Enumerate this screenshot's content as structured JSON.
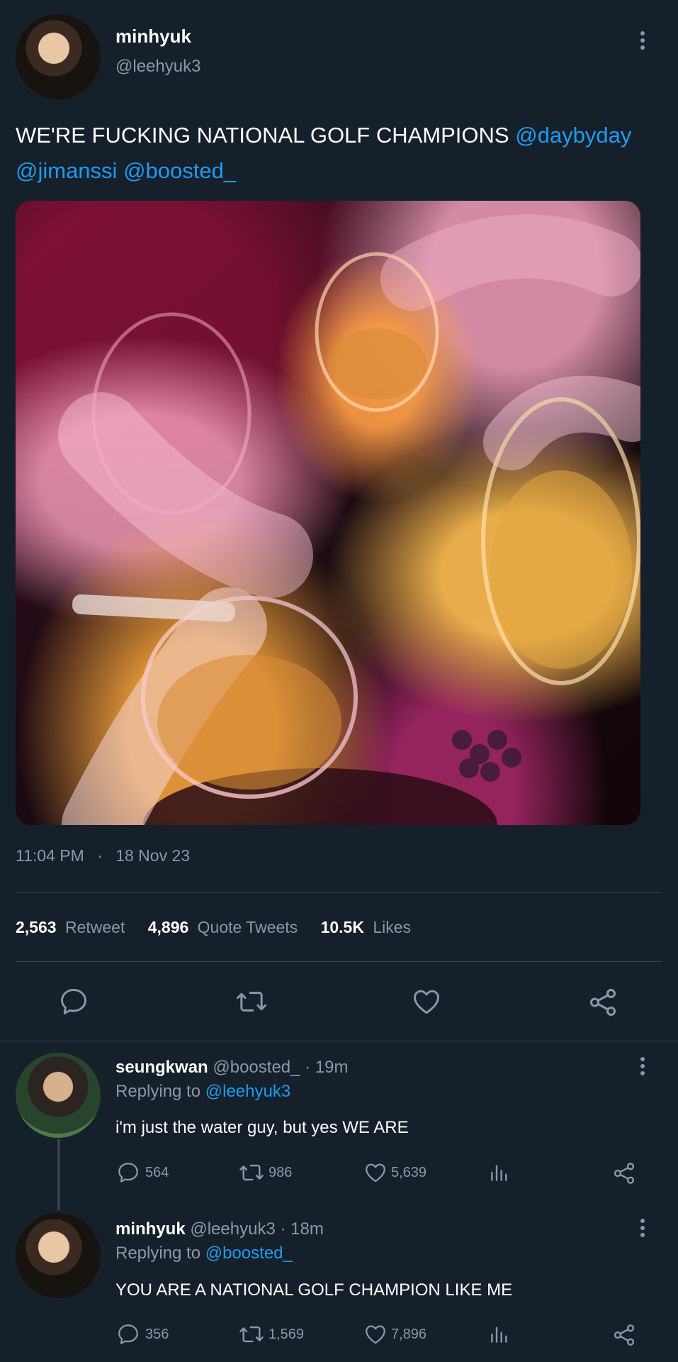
{
  "tweet": {
    "author_name": "minhyuk",
    "author_handle": "@leehyuk3",
    "text_main": "WE'RE FUCKING NATIONAL GOLF CHAMPIONS",
    "mention_1": "@daybyday",
    "mention_2": "@jimanssi",
    "mention_3": "@boosted_",
    "time": "11:04 PM",
    "separator": "·",
    "date": "18 Nov 23",
    "stats": {
      "retweets_count": "2,563",
      "retweets_label": "Retweet",
      "quotes_count": "4,896",
      "quotes_label": "Quote Tweets",
      "likes_count": "10.5K",
      "likes_label": "Likes"
    }
  },
  "replies": [
    {
      "name": "seungkwan",
      "handle": "@boosted_",
      "time": "· 19m",
      "replying_label": "Replying to",
      "replying_to": "@leehyuk3",
      "text": "i'm just the water guy, but yes WE ARE",
      "reply_count": "564",
      "retweet_count": "986",
      "like_count": "5,639"
    },
    {
      "name": "minhyuk",
      "handle": "@leehyuk3",
      "time": "· 18m",
      "replying_label": "Replying to",
      "replying_to": "@boosted_",
      "text": "YOU ARE A NATIONAL GOLF CHAMPION LIKE ME",
      "reply_count": "356",
      "retweet_count": "1,569",
      "like_count": "7,896"
    }
  ],
  "icons": {
    "more": "more-dots-icon",
    "reply": "reply-bubble-icon",
    "retweet": "retweet-icon",
    "like": "heart-icon",
    "share": "share-icon",
    "analytics": "analytics-icon"
  },
  "colors": {
    "background": "#15202b",
    "link": "#1d9bf0",
    "muted": "#8b98a5",
    "divider": "#38444d"
  }
}
